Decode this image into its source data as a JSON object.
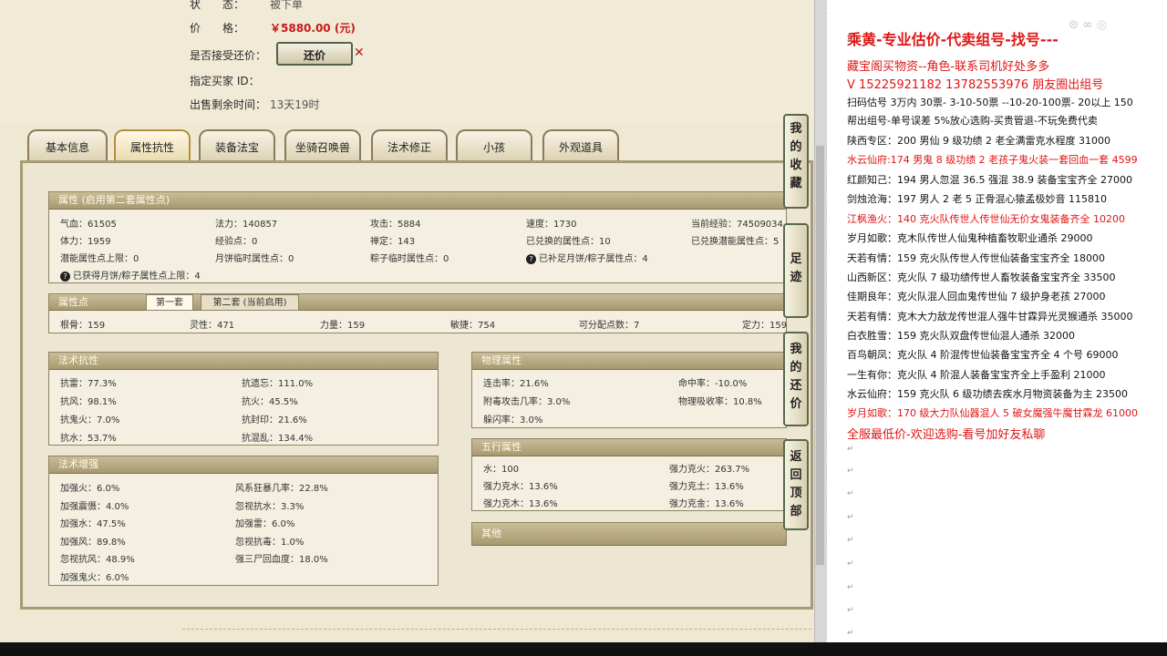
{
  "top": {
    "status_label": "状　　态：",
    "status_value": "被下单",
    "price_label": "价　　格：",
    "price_value": "￥5880.00 (元)",
    "accept_offer_label": "是否接受还价：",
    "offer_button": "还价",
    "buyer_id_label": "指定买家 ID：",
    "remaining_label": "出售剩余时间：",
    "remaining_value": "13天19时"
  },
  "tabs": [
    "基本信息",
    "属性抗性",
    "装备法宝",
    "坐骑召唤兽",
    "法术修正",
    "小孩",
    "外观道具"
  ],
  "attr": {
    "header": "属性 (启用第二套属性点)",
    "rows": [
      [
        "气血：61505",
        "法力：140857",
        "攻击：5884",
        "速度：1730",
        "当前经验：74509034"
      ],
      [
        "体力：1959",
        "经验点：0",
        "禅定：143",
        "已兑换的属性点：10",
        "已兑换潜能属性点：5"
      ],
      [
        "潜能属性点上限：0",
        "月饼临时属性点：0",
        "粽子临时属性点：0",
        "已补足月饼/粽子属性点：4",
        ""
      ]
    ],
    "note": "已获得月饼/粽子属性点上限：4"
  },
  "points": {
    "header": "属性点",
    "tab1": "第一套",
    "tab2": "第二套 (当前启用)",
    "values": [
      "根骨：159",
      "灵性：471",
      "力量：159",
      "敏捷：754",
      "可分配点数：7",
      "定力：159"
    ]
  },
  "resist": {
    "header": "法术抗性",
    "cells": [
      "抗雷：77.3%",
      "抗遗忘：111.0%",
      "抗风：98.1%",
      "抗火：45.5%",
      "抗鬼火：7.0%",
      "抗封印：21.6%",
      "抗水：53.7%",
      "抗混乱：134.4%"
    ]
  },
  "enhance": {
    "header": "法术增强",
    "cells": [
      "加强火：6.0%",
      "风系狂暴几率：22.8%",
      "加强震慑：4.0%",
      "忽视抗水：3.3%",
      "加强水：47.5%",
      "加强雷：6.0%",
      "加强风：89.8%",
      "忽视抗毒：1.0%",
      "忽视抗风：48.9%",
      "强三尸回血度：18.0%",
      "加强鬼火：6.0%",
      ""
    ]
  },
  "physical": {
    "header": "物理属性",
    "cells": [
      "连击率：21.6%",
      "命中率：-10.0%",
      "附毒攻击几率：3.0%",
      "物理吸收率：10.8%",
      "躲闪率：3.0%",
      ""
    ]
  },
  "wuxing": {
    "header": "五行属性",
    "cells": [
      "水：100",
      "强力克火：263.7%",
      "强力克水：13.6%",
      "强力克土：13.6%",
      "强力克木：13.6%",
      "强力克金：13.6%"
    ]
  },
  "other": {
    "header": "其他"
  },
  "side_buttons": [
    [
      "我",
      "的",
      "收",
      "藏"
    ],
    [
      "足",
      "迹"
    ],
    [
      "我",
      "的",
      "还",
      "价"
    ],
    [
      "返",
      "回",
      "顶",
      "部"
    ]
  ],
  "right": {
    "title": "乘黄-专业估价-代卖组号-找号---",
    "lines": [
      {
        "t": "藏宝阁买物资--角色-联系司机好处多多",
        "c": "mid"
      },
      {
        "t": "V 15225921182   13782553976 朋友圈出组号",
        "c": "mid"
      },
      {
        "t": "扫码估号 3万内 30票- 3-10-50票  --10-20-100票- 20以上 150",
        "c": ""
      },
      {
        "t": "帮出组号-单号误差 5%放心选购-买贵管退-不玩免费代卖",
        "c": ""
      },
      {
        "t": "陕西专区：200 男仙 9 级功绩 2 老全满雷克水程度 31000",
        "c": ""
      },
      {
        "t": "水云仙府:174 男鬼 8 级功绩 2 老孩子鬼火装一套回血一套 4599",
        "c": "red"
      },
      {
        "t": "红颜知己：194 男人忽混 36.5 强混 38.9 装备宝宝齐全 27000",
        "c": ""
      },
      {
        "t": "剑烛沧海：197 男人 2 老 5 正骨混心猿孟极妙音 115810",
        "c": ""
      },
      {
        "t": "江枫渔火：140 克火队传世人传世仙无价女鬼装备齐全 10200",
        "c": "red"
      },
      {
        "t": "岁月如歌：克木队传世人仙鬼种植畜牧职业通杀 29000",
        "c": ""
      },
      {
        "t": "天若有情：159 克火队传世人传世仙装备宝宝齐全 18000",
        "c": ""
      },
      {
        "t": "山西新区：克火队 7 级功绩传世人畜牧装备宝宝齐全 33500",
        "c": ""
      },
      {
        "t": "佳期良年：克火队混人回血鬼传世仙 7 级护身老孩 27000",
        "c": ""
      },
      {
        "t": "天若有情：克木大力敌龙传世混人强牛甘霖异光灵猴通杀 35000",
        "c": ""
      },
      {
        "t": "白衣胜雪：159 克火队双盘传世仙混人通杀 32000",
        "c": ""
      },
      {
        "t": "百鸟朝凤：克火队 4 阶混传世仙装备宝宝齐全 4 个号 69000",
        "c": ""
      },
      {
        "t": "一生有你：克火队 4 阶混人装备宝宝齐全上手盈利 21000",
        "c": ""
      },
      {
        "t": "水云仙府：159 克火队 6 级功绩去疾水月物资装备为主 23500",
        "c": ""
      },
      {
        "t": "岁月如歌：170 级大力队仙器混人 5 破女魔强牛魔甘霖龙 61000",
        "c": "red"
      },
      {
        "t": "全服最低价-欢迎选购-看号加好友私聊",
        "c": "mid"
      }
    ]
  }
}
